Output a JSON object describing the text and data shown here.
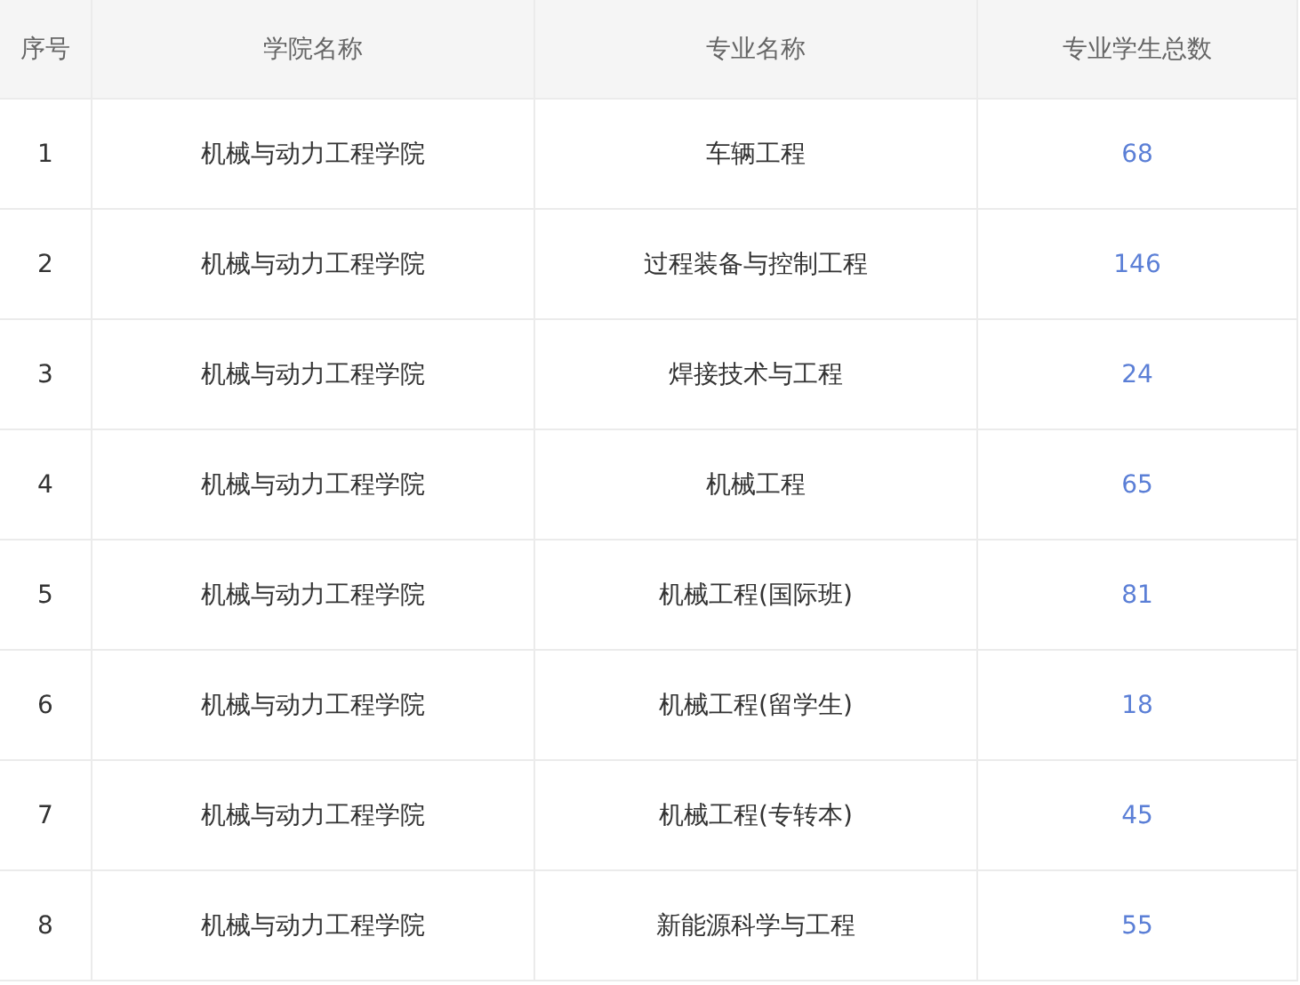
{
  "table": {
    "columns": [
      "序号",
      "学院名称",
      "专业名称",
      "专业学生总数"
    ],
    "rows": [
      {
        "index": "1",
        "college": "机械与动力工程学院",
        "major": "车辆工程",
        "count": "68"
      },
      {
        "index": "2",
        "college": "机械与动力工程学院",
        "major": "过程装备与控制工程",
        "count": "146"
      },
      {
        "index": "3",
        "college": "机械与动力工程学院",
        "major": "焊接技术与工程",
        "count": "24"
      },
      {
        "index": "4",
        "college": "机械与动力工程学院",
        "major": "机械工程",
        "count": "65"
      },
      {
        "index": "5",
        "college": "机械与动力工程学院",
        "major": "机械工程(国际班)",
        "count": "81"
      },
      {
        "index": "6",
        "college": "机械与动力工程学院",
        "major": "机械工程(留学生)",
        "count": "18"
      },
      {
        "index": "7",
        "college": "机械与动力工程学院",
        "major": "机械工程(专转本)",
        "count": "45"
      },
      {
        "index": "8",
        "college": "机械与动力工程学院",
        "major": "新能源科学与工程",
        "count": "55"
      }
    ]
  }
}
